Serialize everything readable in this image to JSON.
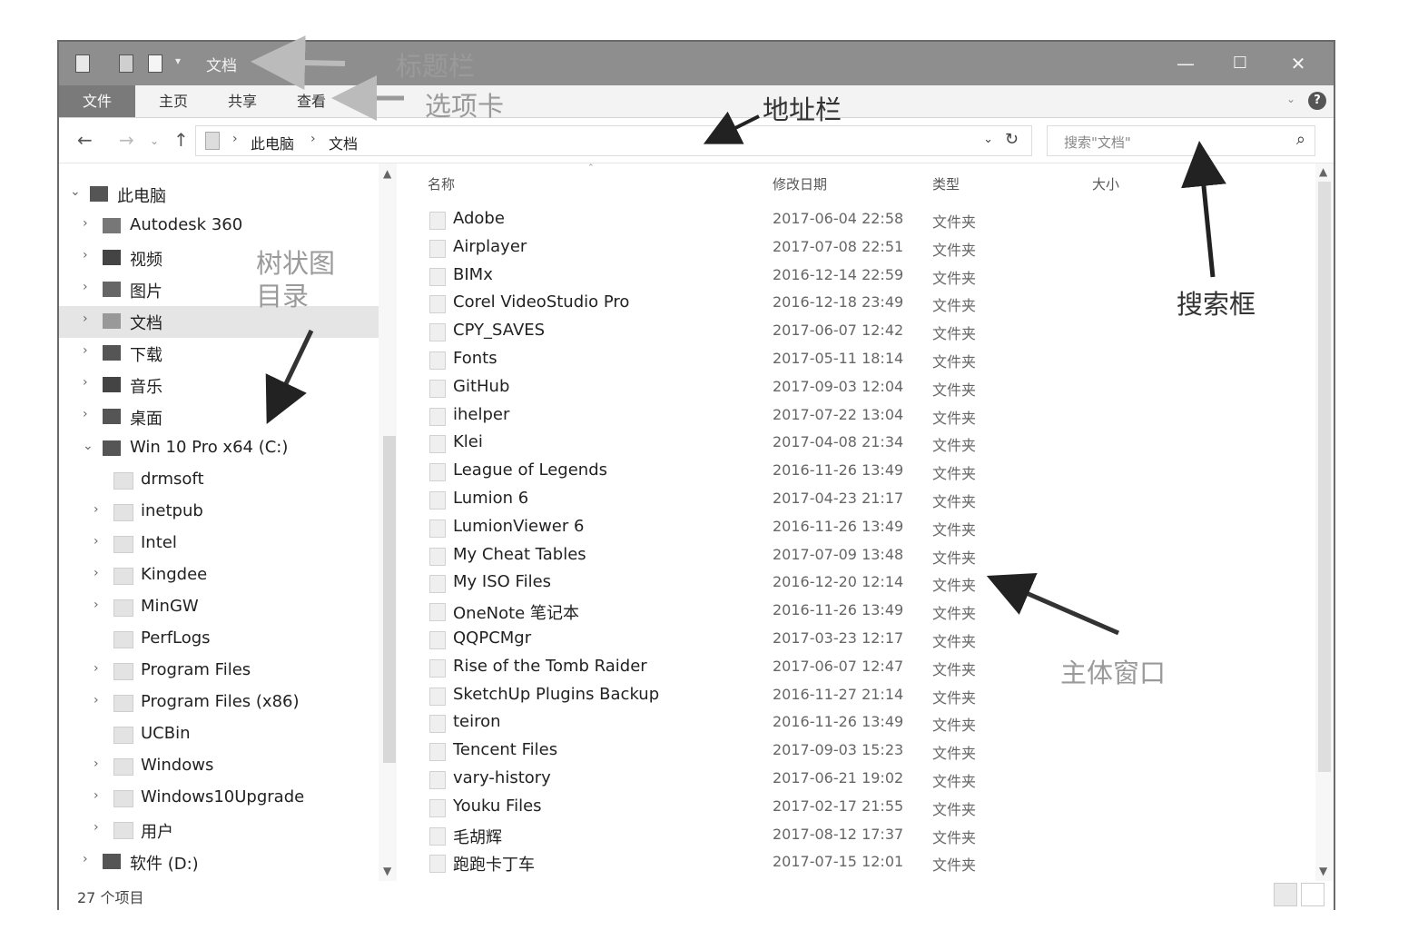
{
  "window": {
    "title": "文档",
    "controls": {
      "minimize": "—",
      "maximize": "☐",
      "close": "✕"
    }
  },
  "ribbon": {
    "tabs": [
      "文件",
      "主页",
      "共享",
      "查看"
    ],
    "help": "?"
  },
  "address_bar": {
    "crumbs": [
      "此电脑",
      "文档"
    ]
  },
  "search": {
    "placeholder": "搜索\"文档\""
  },
  "tree": [
    {
      "label": "此电脑",
      "icon": "computer-icon",
      "arrow": "⌄",
      "level": 0
    },
    {
      "label": "Autodesk 360",
      "icon": "cloud-icon",
      "arrow": "›",
      "level": 1
    },
    {
      "label": "视频",
      "icon": "video-icon",
      "arrow": "›",
      "level": 1
    },
    {
      "label": "图片",
      "icon": "pictures-icon",
      "arrow": "›",
      "level": 1
    },
    {
      "label": "文档",
      "icon": "documents-icon",
      "arrow": "›",
      "level": 1,
      "selected": true
    },
    {
      "label": "下载",
      "icon": "download-icon",
      "arrow": "›",
      "level": 1
    },
    {
      "label": "音乐",
      "icon": "music-icon",
      "arrow": "›",
      "level": 1
    },
    {
      "label": "桌面",
      "icon": "desktop-icon",
      "arrow": "›",
      "level": 1
    },
    {
      "label": "Win 10 Pro x64 (C:)",
      "icon": "drive-icon",
      "arrow": "⌄",
      "level": 1
    },
    {
      "label": "drmsoft",
      "icon": "folder-icon",
      "arrow": "",
      "level": 2
    },
    {
      "label": "inetpub",
      "icon": "folder-icon",
      "arrow": "›",
      "level": 2
    },
    {
      "label": "Intel",
      "icon": "folder-icon",
      "arrow": "›",
      "level": 2
    },
    {
      "label": "Kingdee",
      "icon": "folder-icon",
      "arrow": "›",
      "level": 2
    },
    {
      "label": "MinGW",
      "icon": "folder-icon",
      "arrow": "›",
      "level": 2
    },
    {
      "label": "PerfLogs",
      "icon": "folder-icon",
      "arrow": "",
      "level": 2
    },
    {
      "label": "Program Files",
      "icon": "folder-icon",
      "arrow": "›",
      "level": 2
    },
    {
      "label": "Program Files (x86)",
      "icon": "folder-icon",
      "arrow": "›",
      "level": 2
    },
    {
      "label": "UCBin",
      "icon": "folder-icon",
      "arrow": "",
      "level": 2
    },
    {
      "label": "Windows",
      "icon": "folder-icon",
      "arrow": "›",
      "level": 2
    },
    {
      "label": "Windows10Upgrade",
      "icon": "folder-icon",
      "arrow": "›",
      "level": 2
    },
    {
      "label": "用户",
      "icon": "folder-icon",
      "arrow": "›",
      "level": 2
    },
    {
      "label": "软件 (D:)",
      "icon": "drive-icon",
      "arrow": "›",
      "level": 1
    }
  ],
  "columns": {
    "name": "名称",
    "date": "修改日期",
    "type": "类型",
    "size": "大小"
  },
  "files": [
    {
      "name": "Adobe",
      "date": "2017-06-04 22:58",
      "type": "文件夹"
    },
    {
      "name": "Airplayer",
      "date": "2017-07-08 22:51",
      "type": "文件夹"
    },
    {
      "name": "BIMx",
      "date": "2016-12-14 22:59",
      "type": "文件夹"
    },
    {
      "name": "Corel VideoStudio Pro",
      "date": "2016-12-18 23:49",
      "type": "文件夹"
    },
    {
      "name": "CPY_SAVES",
      "date": "2017-06-07 12:42",
      "type": "文件夹"
    },
    {
      "name": "Fonts",
      "date": "2017-05-11 18:14",
      "type": "文件夹"
    },
    {
      "name": "GitHub",
      "date": "2017-09-03 12:04",
      "type": "文件夹"
    },
    {
      "name": "ihelper",
      "date": "2017-07-22 13:04",
      "type": "文件夹"
    },
    {
      "name": "Klei",
      "date": "2017-04-08 21:34",
      "type": "文件夹"
    },
    {
      "name": "League of Legends",
      "date": "2016-11-26 13:49",
      "type": "文件夹"
    },
    {
      "name": "Lumion 6",
      "date": "2017-04-23 21:17",
      "type": "文件夹"
    },
    {
      "name": "LumionViewer 6",
      "date": "2016-11-26 13:49",
      "type": "文件夹"
    },
    {
      "name": "My Cheat Tables",
      "date": "2017-07-09 13:48",
      "type": "文件夹"
    },
    {
      "name": "My ISO Files",
      "date": "2016-12-20 12:14",
      "type": "文件夹"
    },
    {
      "name": "OneNote 笔记本",
      "date": "2016-11-26 13:49",
      "type": "文件夹"
    },
    {
      "name": "QQPCMgr",
      "date": "2017-03-23 12:17",
      "type": "文件夹"
    },
    {
      "name": "Rise of the Tomb Raider",
      "date": "2017-06-07 12:47",
      "type": "文件夹"
    },
    {
      "name": "SketchUp Plugins Backup",
      "date": "2016-11-27 21:14",
      "type": "文件夹"
    },
    {
      "name": "teiron",
      "date": "2016-11-26 13:49",
      "type": "文件夹"
    },
    {
      "name": "Tencent Files",
      "date": "2017-09-03 15:23",
      "type": "文件夹"
    },
    {
      "name": "vary-history",
      "date": "2017-06-21 19:02",
      "type": "文件夹"
    },
    {
      "name": "Youku Files",
      "date": "2017-02-17 21:55",
      "type": "文件夹"
    },
    {
      "name": "毛胡辉",
      "date": "2017-08-12 17:37",
      "type": "文件夹"
    },
    {
      "name": "跑跑卡丁车",
      "date": "2017-07-15 12:01",
      "type": "文件夹"
    }
  ],
  "status": {
    "item_count": "27 个项目"
  },
  "annotations": {
    "title_bar": "标题栏",
    "tabs": "选项卡",
    "address": "地址栏",
    "tree": "树状图\n目录",
    "search": "搜索框",
    "main": "主体窗口"
  }
}
